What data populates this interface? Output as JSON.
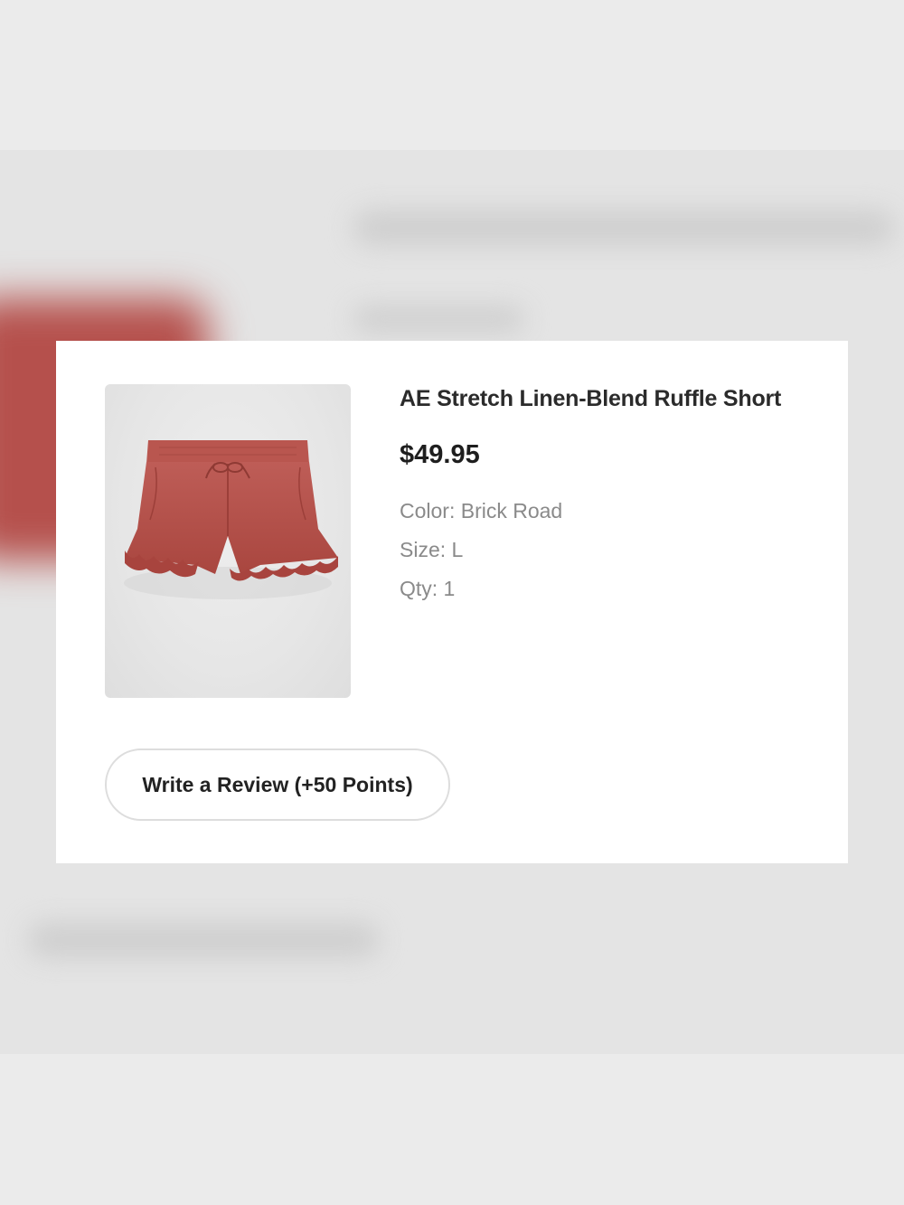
{
  "product": {
    "title": "AE Stretch Linen-Blend Ruffle Short",
    "price": "$49.95",
    "color": "Color: Brick Road",
    "size": "Size: L",
    "qty": "Qty: 1",
    "image_icon": "ruffle-shorts-image",
    "image_color": "#b5524c"
  },
  "actions": {
    "review_label": "Write a Review (+50 Points)"
  }
}
